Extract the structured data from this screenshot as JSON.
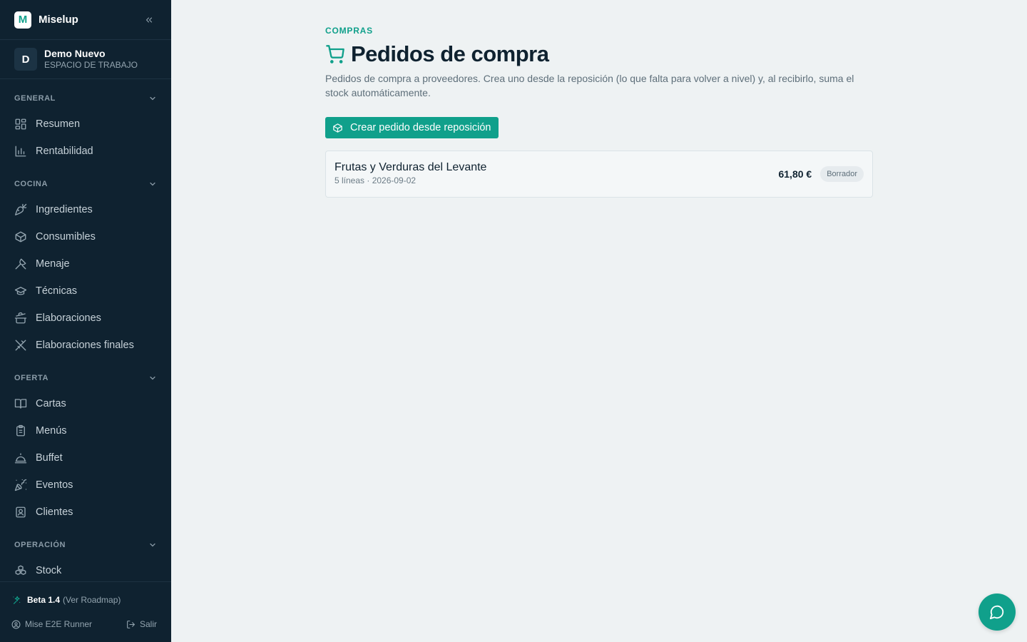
{
  "brand": {
    "logo_letter": "M",
    "name": "Miselup"
  },
  "workspace": {
    "initial": "D",
    "name": "Demo Nuevo",
    "subtitle": "ESPACIO DE TRABAJO"
  },
  "sidebar": {
    "sections": [
      {
        "title": "GENERAL",
        "items": [
          {
            "label": "Resumen",
            "icon": "grid-icon"
          },
          {
            "label": "Rentabilidad",
            "icon": "bar-chart-icon"
          }
        ]
      },
      {
        "title": "COCINA",
        "items": [
          {
            "label": "Ingredientes",
            "icon": "carrot-icon"
          },
          {
            "label": "Consumibles",
            "icon": "package-icon"
          },
          {
            "label": "Menaje",
            "icon": "utensil-icon"
          },
          {
            "label": "Técnicas",
            "icon": "graduation-cap-icon"
          },
          {
            "label": "Elaboraciones",
            "icon": "cooking-pot-icon"
          },
          {
            "label": "Elaboraciones finales",
            "icon": "fork-knife-icon"
          }
        ]
      },
      {
        "title": "OFERTA",
        "items": [
          {
            "label": "Cartas",
            "icon": "book-open-icon"
          },
          {
            "label": "Menús",
            "icon": "clipboard-icon"
          },
          {
            "label": "Buffet",
            "icon": "cloche-icon"
          },
          {
            "label": "Eventos",
            "icon": "party-popper-icon"
          },
          {
            "label": "Clientes",
            "icon": "contact-icon"
          }
        ]
      },
      {
        "title": "OPERACIÓN",
        "items": [
          {
            "label": "Stock",
            "icon": "boxes-icon"
          }
        ]
      }
    ]
  },
  "footer": {
    "version": "Beta 1.4",
    "roadmap_link": "(Ver Roadmap)",
    "user": "Mise E2E Runner",
    "logout": "Salir"
  },
  "main": {
    "eyebrow": "COMPRAS",
    "title": "Pedidos de compra",
    "description": "Pedidos de compra a proveedores. Crea uno desde la reposición (lo que falta para volver a nivel) y, al recibirlo, suma el stock automáticamente.",
    "primary_button": "Crear pedido desde reposición",
    "orders": [
      {
        "supplier": "Frutas y Verduras del Levante",
        "meta": "5 líneas · 2026-09-02",
        "amount": "61,80 €",
        "status": "Borrador"
      }
    ]
  },
  "colors": {
    "accent": "#10a08b",
    "sidebar_bg": "#0f2230",
    "page_bg": "#eef2f3"
  }
}
